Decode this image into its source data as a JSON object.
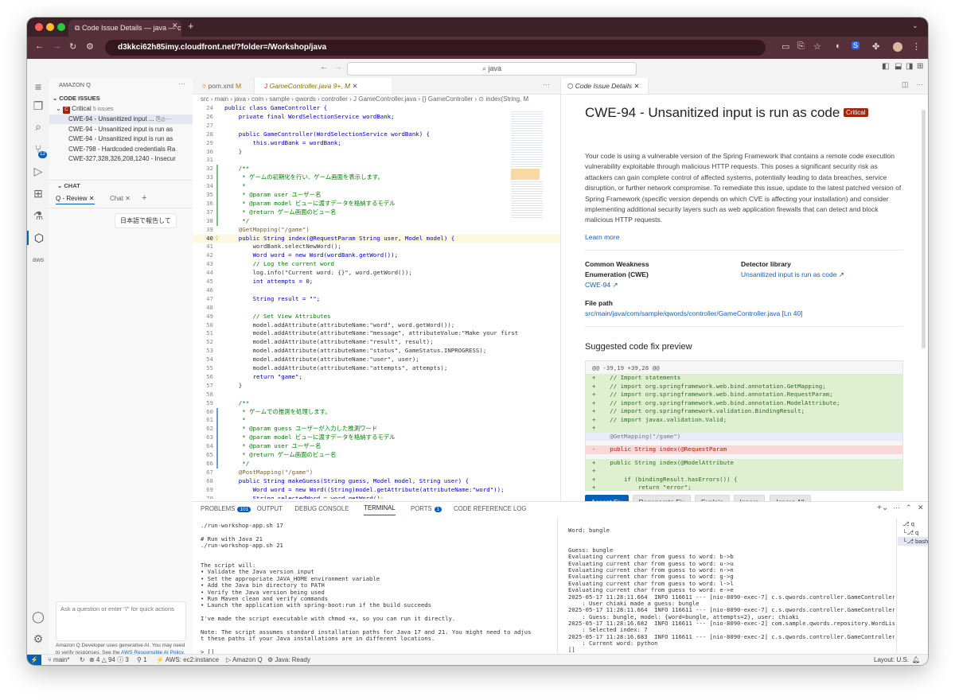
{
  "browser": {
    "tab_title": "Code Issue Details — java — c",
    "url": "d3kkci62h85imy.cloudfront.net/?folder=/Workshop/java"
  },
  "vscode": {
    "search": "java"
  },
  "sidebar": {
    "header": "AMAZON Q",
    "section": "CODE ISSUES",
    "group_label": "Critical",
    "group_count": "5 issues",
    "issues": [
      {
        "text": "CWE-94 - Unsanitized input ..."
      },
      {
        "text": "CWE-94 - Unsanitized input is run as"
      },
      {
        "text": "CWE-94 - Unsanitized input is run as"
      },
      {
        "text": "CWE-798 - Hardcoded credentials  Ra"
      },
      {
        "text": "CWE-327,328,326,208,1240 - Insecur"
      }
    ],
    "chat_header": "CHAT",
    "chat_tabs": [
      "Q - Review",
      "Chat"
    ],
    "chat_message": "日本語で報告して",
    "chat_input_placeholder": "Ask a question or enter \"/\" for quick actions",
    "disclaimer_text": "Amazon Q Developer uses generative AI. You may need to verify responses. See the",
    "disclaimer_link": "AWS Responsible AI Policy",
    "disclaimer_end": "."
  },
  "activity_badge": "12",
  "editor": {
    "tabs": [
      {
        "label": "pom.xml",
        "badge": "M"
      },
      {
        "label": "GameController.java",
        "badge": "9+, M"
      }
    ],
    "breadcrumb": "src › main › java › com › sample › qwords › controller › J GameController.java › {} GameController › ⊙ index(String, M",
    "lines": [
      {
        "n": "24",
        "t": "public class GameController {"
      },
      {
        "n": "26",
        "t": "    private final WordSelectionService wordBank;"
      },
      {
        "n": "27",
        "t": ""
      },
      {
        "n": "28",
        "t": "    public GameController(WordSelectionService wordBank) {"
      },
      {
        "n": "29",
        "t": "        this.wordBank = wordBank;"
      },
      {
        "n": "30",
        "t": "    }"
      },
      {
        "n": "31",
        "t": ""
      },
      {
        "n": "32",
        "t": "    /**"
      },
      {
        "n": "33",
        "t": "     * ゲームの初期化を行い、ゲーム画面を表示します。"
      },
      {
        "n": "34",
        "t": "     *"
      },
      {
        "n": "35",
        "t": "     * @param user ユーザー名"
      },
      {
        "n": "36",
        "t": "     * @param model ビューに渡すデータを格納するモデル"
      },
      {
        "n": "37",
        "t": "     * @return ゲーム画面のビュー名"
      },
      {
        "n": "38",
        "t": "     */"
      },
      {
        "n": "39",
        "t": "    @GetMapping(\"/game\")"
      },
      {
        "n": "40",
        "t": "    public String index(@RequestParam String user, Model model) {"
      },
      {
        "n": "41",
        "t": "        wordBank.selectNewWord();"
      },
      {
        "n": "42",
        "t": "        Word word = new Word(wordBank.getWord());"
      },
      {
        "n": "43",
        "t": "        // Log the current word"
      },
      {
        "n": "44",
        "t": "        log.info(\"Current word: {}\", word.getWord());"
      },
      {
        "n": "45",
        "t": "        int attempts = 0;"
      },
      {
        "n": "46",
        "t": ""
      },
      {
        "n": "47",
        "t": "        String result = \"\";"
      },
      {
        "n": "48",
        "t": ""
      },
      {
        "n": "49",
        "t": "        // Set View Attributes"
      },
      {
        "n": "50",
        "t": "        model.addAttribute(attributeName:\"word\", word.getWord());"
      },
      {
        "n": "51",
        "t": "        model.addAttribute(attributeName:\"message\", attributeValue:\"Make your first"
      },
      {
        "n": "52",
        "t": "        model.addAttribute(attributeName:\"result\", result);"
      },
      {
        "n": "53",
        "t": "        model.addAttribute(attributeName:\"status\", GameStatus.INPROGRESS);"
      },
      {
        "n": "54",
        "t": "        model.addAttribute(attributeName:\"user\", user);"
      },
      {
        "n": "55",
        "t": "        model.addAttribute(attributeName:\"attempts\", attempts);"
      },
      {
        "n": "56",
        "t": "        return \"game\";"
      },
      {
        "n": "57",
        "t": "    }"
      },
      {
        "n": "58",
        "t": ""
      },
      {
        "n": "59",
        "t": "    /**"
      },
      {
        "n": "60",
        "t": "     * ゲームでの推測を処理します。"
      },
      {
        "n": "61",
        "t": "     *"
      },
      {
        "n": "62",
        "t": "     * @param guess ユーザーが入力した推測ワード"
      },
      {
        "n": "63",
        "t": "     * @param model ビューに渡すデータを格納するモデル"
      },
      {
        "n": "64",
        "t": "     * @param user ユーザー名"
      },
      {
        "n": "65",
        "t": "     * @return ゲーム画面のビュー名"
      },
      {
        "n": "66",
        "t": "     */"
      },
      {
        "n": "67",
        "t": "    @PostMapping(\"/game\")"
      },
      {
        "n": "68",
        "t": "    public String makeGuess(String guess, Model model, String user) {"
      },
      {
        "n": "69",
        "t": "        Word word = new Word((String)model.getAttribute(attributeName:\"word\"));"
      },
      {
        "n": "70",
        "t": "        String selectedWord = word.getWord();"
      }
    ]
  },
  "detail": {
    "tab": "Code Issue Details",
    "title": "CWE-94 - Unsanitized input is run as code",
    "severity": "Critical",
    "description": "Your code is using a vulnerable version of the Spring Framework that contains a remote code execution vulnerability exploitable through malicious HTTP requests. This poses a significant security risk as attackers can gain complete control of affected systems, potentially leading to data breaches, service disruption, or further network compromise. To remediate this issue, update to the latest patched version of Spring Framework (specific version depends on which CVE is affecting your installation) and consider implementing additional security layers such as web application firewalls that can detect and block malicious HTTP requests.",
    "learn_more": "Learn more",
    "cwe_label_1": "Common Weakness",
    "cwe_label_2": "Enumeration (CWE)",
    "cwe_value": "CWE-94",
    "detector_label": "Detector library",
    "detector_value": "Unsanitized input is run as code",
    "file_label": "File path",
    "file_value": "src/main/java/com/sample/qwords/controller/GameController.java [Ln 40]",
    "fix_header": "Suggested code fix preview",
    "diff": [
      {
        "k": "hdr",
        "t": "@@ -39,19 +39,28 @@"
      },
      {
        "k": "add",
        "t": "+    // Import statements"
      },
      {
        "k": "add",
        "t": "+    // import org.springframework.web.bind.annotation.GetMapping;"
      },
      {
        "k": "add",
        "t": "+    // import org.springframework.web.bind.annotation.RequestParam;"
      },
      {
        "k": "add",
        "t": "+    // import org.springframework.web.bind.annotation.ModelAttribute;"
      },
      {
        "k": "add",
        "t": "+    // import org.springframework.validation.BindingResult;"
      },
      {
        "k": "add",
        "t": "+    // import javax.validation.Valid;"
      },
      {
        "k": "add",
        "t": "+"
      },
      {
        "k": "ctx",
        "t": "     @GetMapping(\"/game\")"
      },
      {
        "k": "gap",
        "t": ""
      },
      {
        "k": "del",
        "t": "-    public String index(@RequestParam"
      },
      {
        "k": "gap",
        "t": ""
      },
      {
        "k": "add",
        "t": "+    public String index(@ModelAttribute"
      },
      {
        "k": "add",
        "t": "+"
      },
      {
        "k": "add",
        "t": "+        if (bindingResult.hasErrors()) {"
      },
      {
        "k": "add",
        "t": "+            return \"error\";"
      },
      {
        "k": "add",
        "t": "+        }"
      }
    ],
    "buttons": [
      "Accept Fix",
      "Regenerate Fix",
      "Explain",
      "Ignore",
      "Ignore All"
    ]
  },
  "panel": {
    "tabs": [
      {
        "label": "PROBLEMS",
        "badge": "101"
      },
      {
        "label": "OUTPUT",
        "badge": ""
      },
      {
        "label": "DEBUG CONSOLE",
        "badge": ""
      },
      {
        "label": "TERMINAL",
        "badge": ""
      },
      {
        "label": "PORTS",
        "badge": "1"
      },
      {
        "label": "CODE REFERENCE LOG",
        "badge": ""
      }
    ],
    "terminal_left": [
      "./run-workshop-app.sh 17",
      "",
      "# Run with Java 21",
      "./run-workshop-app.sh 21",
      "",
      "",
      "The script will:",
      "• Validate the Java version input",
      "• Set the appropriate JAVA_HOME environment variable",
      "• Add the Java bin directory to PATH",
      "• Verify the Java version being used",
      "• Run Maven clean and verify commands",
      "• Launch the application with spring-boot:run if the build succeeds",
      "",
      "I've made the script executable with chmod +x, so you can run it directly.",
      "",
      "Note: The script assumes standard installation paths for Java 17 and 21. You might need to adjus",
      "t these paths if your Java installations are in different locations.",
      "",
      "> []"
    ],
    "terminal_right": [
      "Word: bungle",
      "",
      "",
      "Guess: bungle",
      "Evaluating current char from guess to word: b->b",
      "Evaluating current char from guess to word: u->u",
      "Evaluating current char from guess to word: n->n",
      "Evaluating current char from guess to word: g->g",
      "Evaluating current char from guess to word: l->l",
      "Evaluating current char from guess to word: e->e",
      "2025-05-17 11:28:11.664  INFO 116611 --- [nio-8090-exec-7] c.s.qwords.controller.GameController",
      "    : User chiaki made a guess: bungle",
      "2025-05-17 11:28:11.664  INFO 116611 --- [nio-8090-exec-7] c.s.qwords.controller.GameController",
      "    : Guess: bungle, model: {word=bungle, attempts=2}, user: chiaki",
      "2025-05-17 11:28:16.682  INFO 116611 --- [nio-8090-exec-2] com.sample.qwords.repository.WordList",
      "    : Selected index: 7",
      "2025-05-17 11:28:16.683  INFO 116611 --- [nio-8090-exec-2] c.s.qwords.controller.GameController",
      "    : Current word: python",
      "[]"
    ],
    "terminals": [
      "q",
      "q",
      "bash"
    ]
  },
  "statusbar": {
    "branch": "main*",
    "errors": "⊗ 4 △ 94 ⓘ 3",
    "ports": "⚲ 1",
    "aws": "AWS: ec2:instance",
    "amazonq": "Amazon Q",
    "java": "Java: Ready",
    "layout": "Layout: U.S."
  },
  "colors": {
    "accent": "#005fb8",
    "critical": "#a1260d",
    "diff_add": "#dff0d0",
    "diff_del": "#f7d7d7",
    "diff_ctx": "#e7ecf7",
    "chrome": "#55303a"
  }
}
